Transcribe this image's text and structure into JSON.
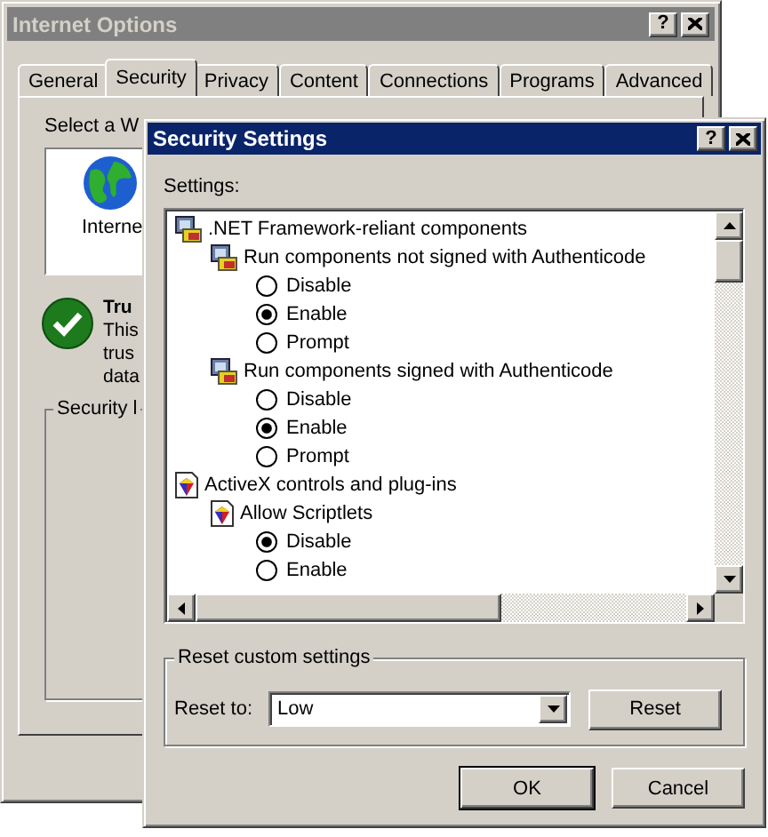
{
  "background_window": {
    "title": "Internet Options",
    "help_button": "?",
    "tabs": [
      {
        "label": "General",
        "selected": false
      },
      {
        "label": "Security",
        "selected": true
      },
      {
        "label": "Privacy",
        "selected": false
      },
      {
        "label": "Content",
        "selected": false
      },
      {
        "label": "Connections",
        "selected": false
      },
      {
        "label": "Programs",
        "selected": false
      },
      {
        "label": "Advanced",
        "selected": false
      }
    ],
    "zone_prompt": "Select a W",
    "zone_label": "Interne",
    "zone_title": "Tru",
    "zone_description": [
      "This",
      "trus",
      "data"
    ],
    "security_level_label": "Security l"
  },
  "dialog": {
    "title": "Security Settings",
    "help_button": "?",
    "settings_label": "Settings:",
    "settings_tree": [
      {
        "kind": "net",
        "label": ".NET Framework-reliant components",
        "children": [
          {
            "kind": "net",
            "label": "Run components not signed with Authenticode",
            "children": [
              {
                "kind": "option",
                "label": "Disable",
                "selected": false
              },
              {
                "kind": "option",
                "label": "Enable",
                "selected": true
              },
              {
                "kind": "option",
                "label": "Prompt",
                "selected": false
              }
            ]
          },
          {
            "kind": "net",
            "label": "Run components signed with Authenticode",
            "children": [
              {
                "kind": "option",
                "label": "Disable",
                "selected": false
              },
              {
                "kind": "option",
                "label": "Enable",
                "selected": true
              },
              {
                "kind": "option",
                "label": "Prompt",
                "selected": false
              }
            ]
          }
        ]
      },
      {
        "kind": "activex",
        "label": "ActiveX controls and plug-ins",
        "children": [
          {
            "kind": "activex",
            "label": "Allow Scriptlets",
            "children": [
              {
                "kind": "option",
                "label": "Disable",
                "selected": true
              },
              {
                "kind": "option",
                "label": "Enable",
                "selected": false
              }
            ]
          }
        ]
      }
    ],
    "reset_group": {
      "title": "Reset custom settings",
      "reset_to_label": "Reset to:",
      "reset_to_value": "Low",
      "reset_button": "Reset"
    },
    "buttons": [
      "OK",
      "Cancel"
    ]
  }
}
